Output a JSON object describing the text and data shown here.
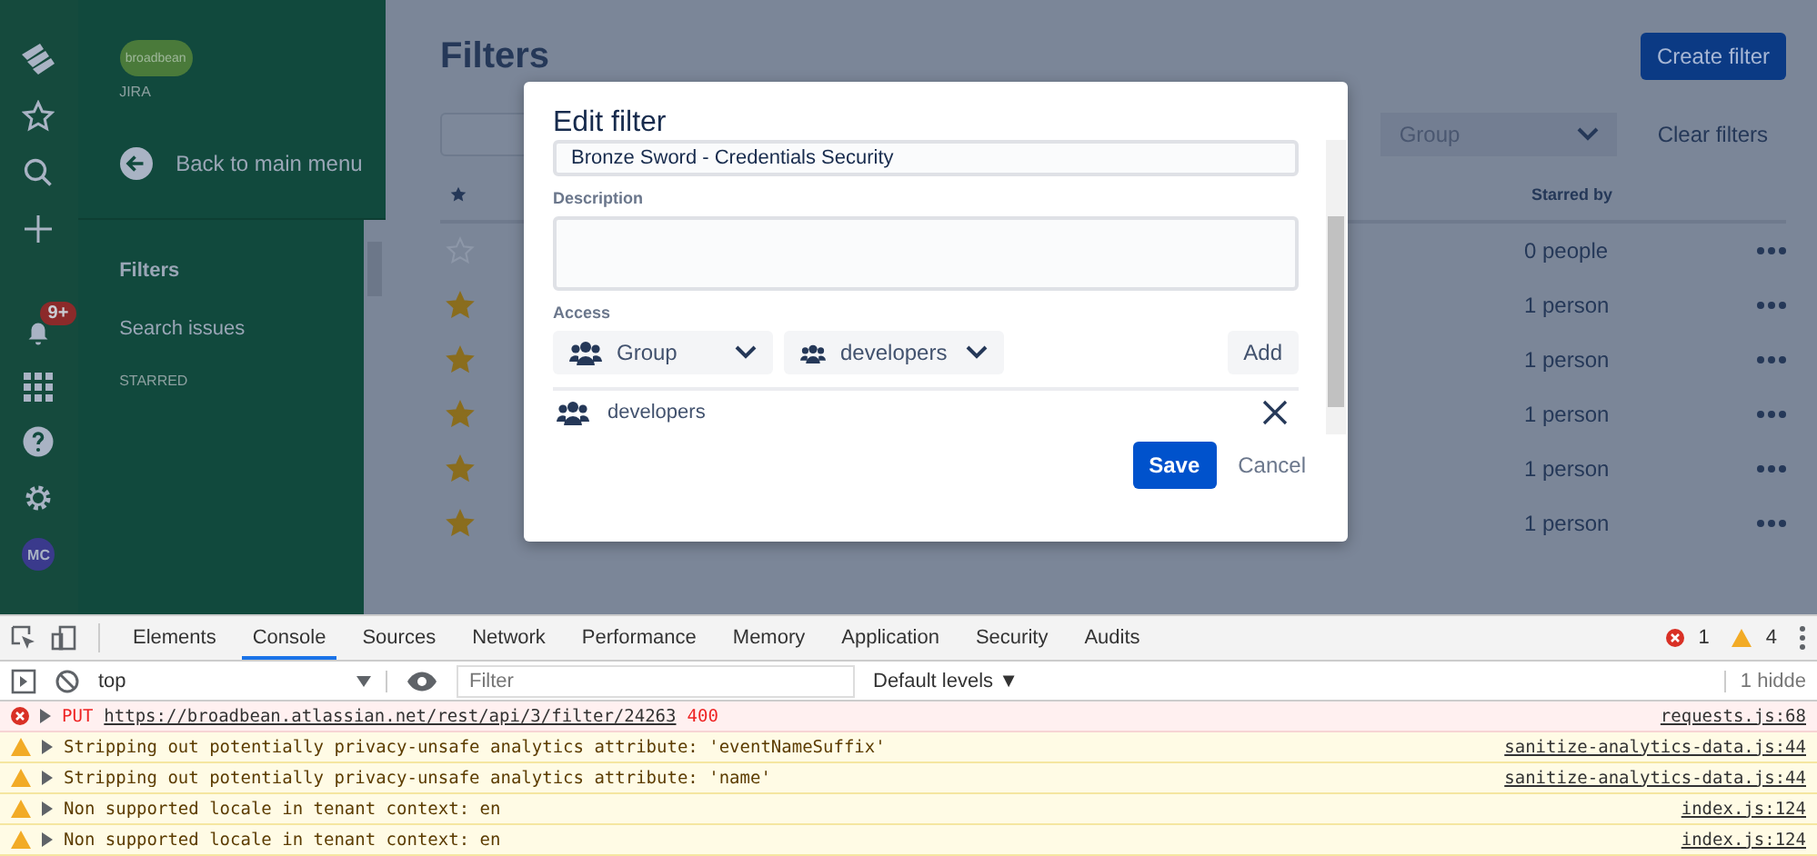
{
  "rail": {
    "notifications_badge": "9+",
    "avatar": "MC"
  },
  "sidebar": {
    "logo_text": "broadbean",
    "product": "JIRA",
    "back": "Back to main menu",
    "items": [
      {
        "label": "Filters",
        "selected": true
      },
      {
        "label": "Search issues",
        "selected": false
      }
    ],
    "section": "STARRED"
  },
  "page": {
    "title": "Filters",
    "create_button": "Create filter",
    "group_filter": "Group",
    "clear": "Clear filters",
    "starred_column": "Starred by",
    "rows": [
      {
        "starred": false,
        "starred_by": "0 people"
      },
      {
        "starred": true,
        "starred_by": "1 person"
      },
      {
        "starred": true,
        "starred_by": "1 person"
      },
      {
        "starred": true,
        "starred_by": "1 person"
      },
      {
        "starred": true,
        "starred_by": "1 person"
      },
      {
        "starred": true,
        "starred_by": "1 person"
      }
    ]
  },
  "dialog": {
    "title": "Edit filter",
    "name_value": "Bronze Sword - Credentials Security",
    "description_label": "Description",
    "access_label": "Access",
    "type_select": "Group",
    "group_select": "developers",
    "add": "Add",
    "shares": [
      {
        "name": "developers"
      }
    ],
    "save": "Save",
    "cancel": "Cancel"
  },
  "devtools": {
    "tabs": [
      {
        "label": "Elements",
        "selected": false
      },
      {
        "label": "Console",
        "selected": true
      },
      {
        "label": "Sources",
        "selected": false
      },
      {
        "label": "Network",
        "selected": false
      },
      {
        "label": "Performance",
        "selected": false
      },
      {
        "label": "Memory",
        "selected": false
      },
      {
        "label": "Application",
        "selected": false
      },
      {
        "label": "Security",
        "selected": false
      },
      {
        "label": "Audits",
        "selected": false
      }
    ],
    "errors": "1",
    "warnings": "4",
    "context": "top",
    "filter_placeholder": "Filter",
    "levels": "Default levels ▼",
    "hidden": "1 hidde",
    "messages": [
      {
        "kind": "error",
        "method": "PUT",
        "url": "https://broadbean.atlassian.net/rest/api/3/filter/24263",
        "status": "400",
        "source": "requests.js:68"
      },
      {
        "kind": "warning",
        "text": "Stripping out potentially privacy-unsafe analytics attribute: 'eventNameSuffix'",
        "source": "sanitize-analytics-data.js:44"
      },
      {
        "kind": "warning",
        "text": "Stripping out potentially privacy-unsafe analytics attribute: 'name'",
        "source": "sanitize-analytics-data.js:44"
      },
      {
        "kind": "warning",
        "text": "Non supported locale in tenant context: en",
        "source": "index.js:124"
      },
      {
        "kind": "warning",
        "text": "Non supported locale in tenant context: en",
        "source": "index.js:124"
      }
    ]
  }
}
